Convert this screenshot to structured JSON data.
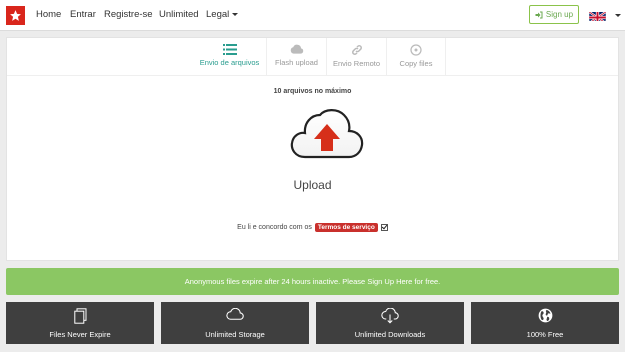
{
  "nav": {
    "items": [
      "Home",
      "Entrar",
      "Registre-se",
      "Unlimited",
      "Legal"
    ],
    "signup_label": "Sign up",
    "language_icon": "uk-flag-icon"
  },
  "tabs": [
    {
      "label": "Envio de arquivos",
      "icon": "list-icon",
      "active": true
    },
    {
      "label": "Flash upload",
      "icon": "cloud-icon",
      "active": false
    },
    {
      "label": "Envio Remoto",
      "icon": "link-icon",
      "active": false
    },
    {
      "label": "Copy files",
      "icon": "disc-icon",
      "active": false
    }
  ],
  "upload": {
    "max_files": "10 arquivos no máximo",
    "label": "Upload",
    "terms_text": "Eu li e concordo com os",
    "terms_link": "Termos de serviço",
    "terms_checked": true
  },
  "notice": "Anonymous files expire after 24 hours inactive. Please Sign Up Here for free.",
  "features": [
    {
      "label": "Files Never Expire",
      "icon": "files-icon"
    },
    {
      "label": "Unlimited Storage",
      "icon": "cloud-icon"
    },
    {
      "label": "Unlimited Downloads",
      "icon": "cloud-download-icon"
    },
    {
      "label": "100% Free",
      "icon": "globe-icon"
    }
  ],
  "colors": {
    "brand_red": "#d9261c",
    "accent_teal": "#2a9d8f",
    "success_green": "#8bc763",
    "feature_bg": "#3f3f3f"
  }
}
